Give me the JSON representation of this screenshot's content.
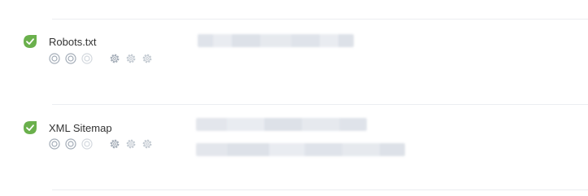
{
  "checks": [
    {
      "title": "Robots.txt",
      "status_icon": "check-leaf-icon",
      "status_color": "#6ab04c",
      "tool_icons": [
        "target-icon",
        "target-icon",
        "target-faded-icon",
        "gear-icon",
        "gear-icon",
        "gear-faded-icon"
      ]
    },
    {
      "title": "XML Sitemap",
      "status_icon": "check-leaf-icon",
      "status_color": "#6ab04c",
      "tool_icons": [
        "target-icon",
        "target-icon",
        "target-faded-icon",
        "gear-icon",
        "gear-icon",
        "gear-faded-icon"
      ]
    }
  ],
  "colors": {
    "icon_gray": "#a3acb7",
    "icon_faded": "#d3d8de",
    "divider": "#eceef1",
    "redaction": "#dfe3ea"
  }
}
